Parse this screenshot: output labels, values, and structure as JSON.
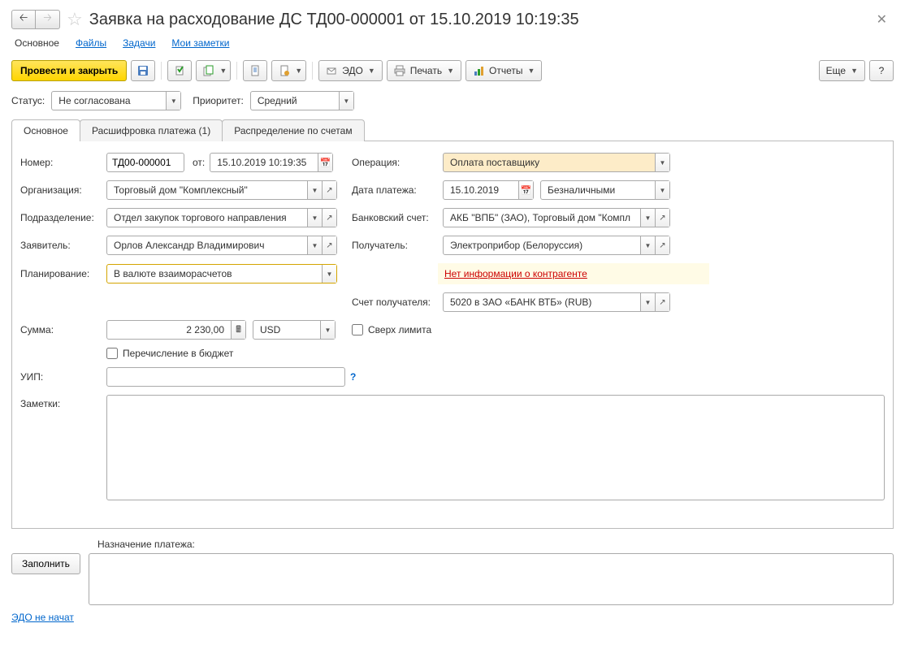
{
  "header": {
    "title": "Заявка на расходование ДС ТД00-000001 от 15.10.2019 10:19:35"
  },
  "topTabs": {
    "main": "Основное",
    "files": "Файлы",
    "tasks": "Задачи",
    "notes": "Мои заметки"
  },
  "toolbar": {
    "post_close": "Провести и закрыть",
    "edo": "ЭДО",
    "print": "Печать",
    "reports": "Отчеты",
    "more": "Еще",
    "help": "?"
  },
  "statusRow": {
    "status_lbl": "Статус:",
    "status_val": "Не согласована",
    "priority_lbl": "Приоритет:",
    "priority_val": "Средний"
  },
  "midTabs": {
    "t1": "Основное",
    "t2": "Расшифровка платежа (1)",
    "t3": "Распределение по счетам"
  },
  "form": {
    "number_lbl": "Номер:",
    "number_val": "ТД00-000001",
    "from_lbl": "от:",
    "date_val": "15.10.2019 10:19:35",
    "operation_lbl": "Операция:",
    "operation_val": "Оплата поставщику",
    "org_lbl": "Организация:",
    "org_val": "Торговый дом \"Комплексный\"",
    "paydate_lbl": "Дата платежа:",
    "paydate_val": "15.10.2019",
    "paytype_val": "Безналичными",
    "dept_lbl": "Подразделение:",
    "dept_val": "Отдел закупок торгового направления",
    "bank_lbl": "Банковский счет:",
    "bank_val": "АКБ \"ВПБ\" (ЗАО), Торговый дом \"Компл",
    "applicant_lbl": "Заявитель:",
    "applicant_val": "Орлов Александр Владимирович",
    "recipient_lbl": "Получатель:",
    "recipient_val": "Электроприбор (Белоруссия)",
    "planning_lbl": "Планирование:",
    "planning_val": "В валюте взаиморасчетов",
    "warning": "Нет информации о контрагенте",
    "recacc_lbl": "Счет получателя:",
    "recacc_val": "5020 в ЗАО «БАНК ВТБ» (RUB)",
    "sum_lbl": "Сумма:",
    "sum_val": "2 230,00",
    "currency_val": "USD",
    "overlimit_lbl": "Сверх лимита",
    "budget_lbl": "Перечисление в бюджет",
    "uip_lbl": "УИП:",
    "notes_lbl": "Заметки:"
  },
  "footer": {
    "purpose_lbl": "Назначение платежа:",
    "fill_btn": "Заполнить",
    "edo_status": "ЭДО не начат"
  }
}
